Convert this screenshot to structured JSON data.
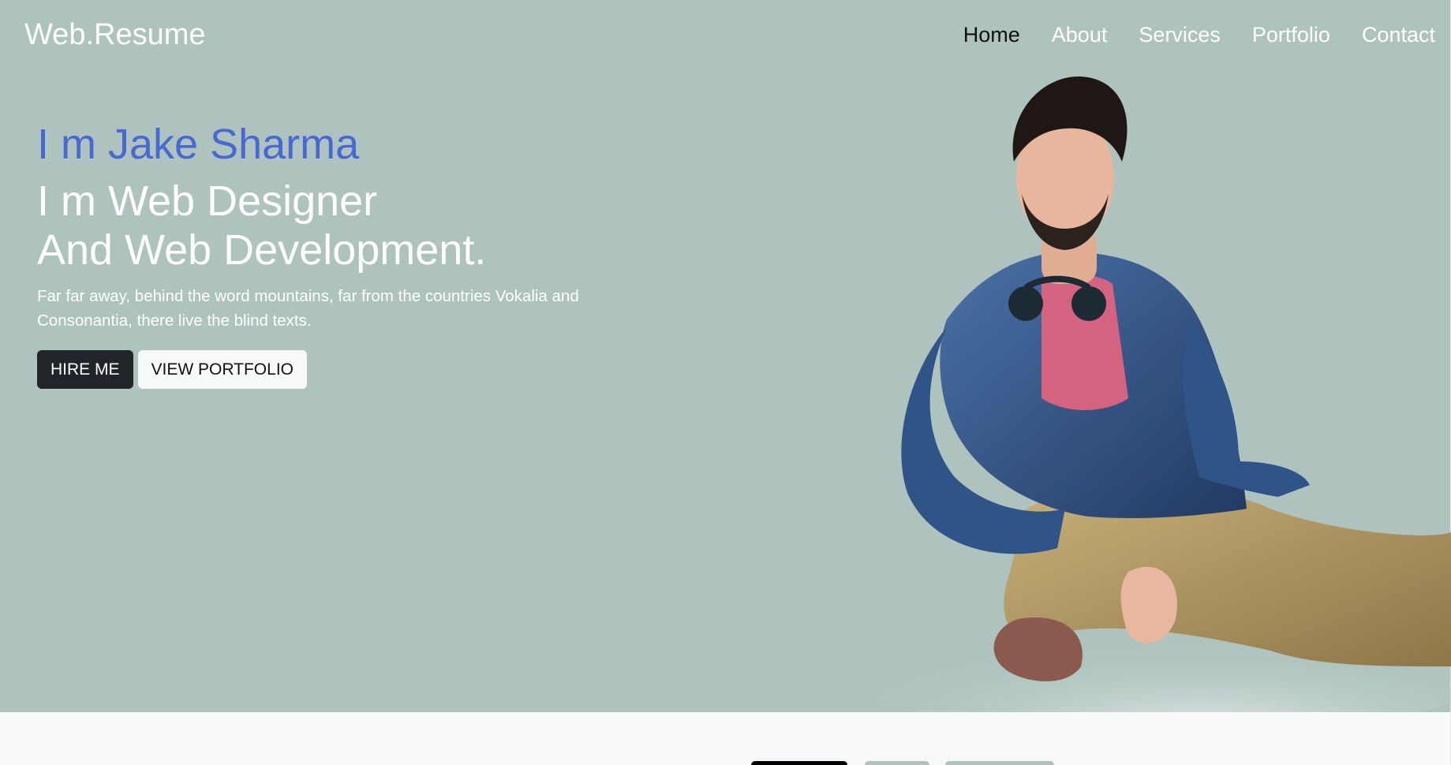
{
  "navbar": {
    "brand": "Web.Resume",
    "links": [
      {
        "label": "Home",
        "active": true
      },
      {
        "label": "About"
      },
      {
        "label": "Services"
      },
      {
        "label": "Portfolio"
      },
      {
        "label": "Contact"
      }
    ]
  },
  "hero": {
    "name": "I m Jake Sharma",
    "title_line1": "I m Web Designer",
    "title_line2": "And Web Development.",
    "description": "Far far away, behind the word mountains, far from the countries Vokalia and Consonantia, there live the blind texts.",
    "hire_button": "HIRE ME",
    "portfolio_button": "VIEW PORTFOLIO"
  },
  "colors": {
    "hero_bg": "#aec3be",
    "name_accent": "#4868d6",
    "dark_button": "#212529",
    "light_button": "#f8f9fa"
  },
  "icons": {
    "portrait": "person-portrait-image"
  }
}
